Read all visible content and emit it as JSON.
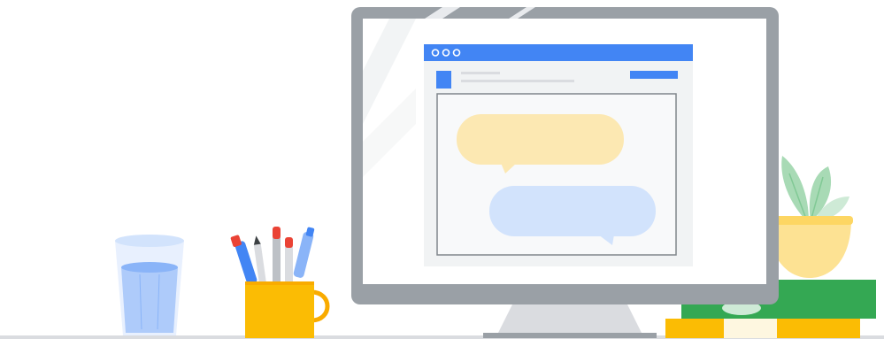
{
  "scene": {
    "description_items": [
      "water-glass",
      "pen-cup",
      "desktop-monitor",
      "chat-window",
      "potted-plant",
      "book-stack"
    ]
  },
  "colors": {
    "monitor_frame": "#9aa0a6",
    "monitor_screen": "#ffffff",
    "browser_bar": "#4285f4",
    "window_bg": "#f1f3f4",
    "chat_bubble_left": "#fce8b2",
    "chat_bubble_right": "#d2e3fc",
    "glass": "#e8f0fe",
    "water": "#aecbfa",
    "cup": "#fbbc04",
    "plant": "#a8dab5",
    "pot": "#fde293",
    "book_green": "#34a853",
    "book_yellow": "#fbbc04",
    "floor": "#dadce0"
  },
  "icons": {
    "window_dots": "three-dots-icon"
  }
}
